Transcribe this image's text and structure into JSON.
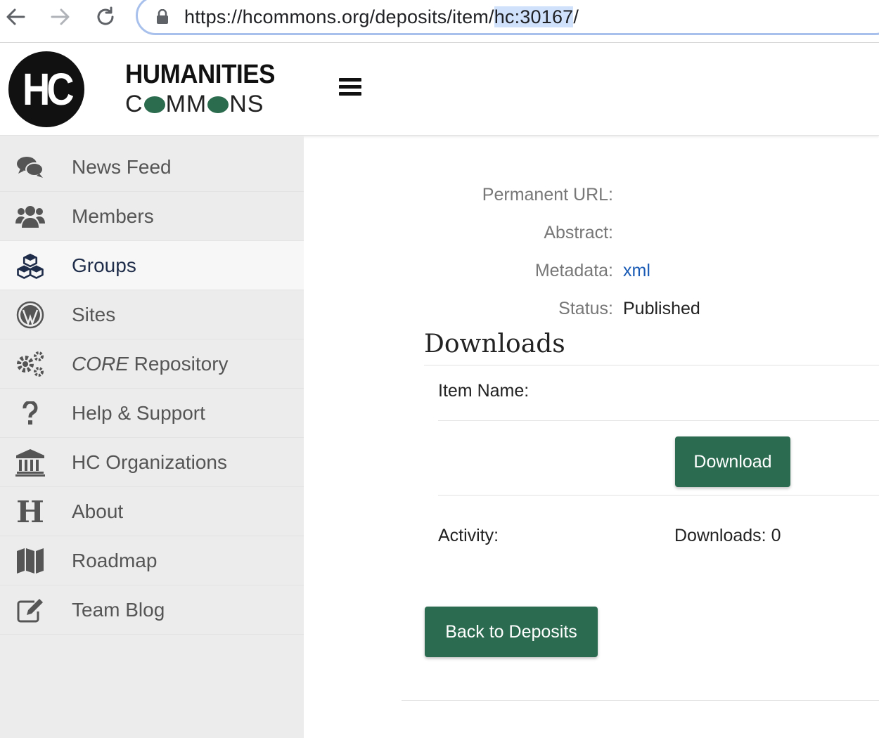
{
  "browser": {
    "url_prefix": "https://hcommons.org/deposits/item/",
    "url_highlight": "hc:30167",
    "url_suffix": "/"
  },
  "header": {
    "logo_text": "HC",
    "brand_top": "HUMANITIES",
    "brand_bottom_parts": [
      "C",
      "MM",
      "NS"
    ]
  },
  "sidebar": {
    "items": [
      {
        "label": "News Feed",
        "icon": "comments-icon"
      },
      {
        "label": "Members",
        "icon": "users-icon"
      },
      {
        "label": "Groups",
        "icon": "cubes-icon",
        "active": true
      },
      {
        "label": "Sites",
        "icon": "wordpress-icon"
      },
      {
        "label_em": "CORE",
        "label": " Repository",
        "icon": "gears-icon"
      },
      {
        "label": "Help & Support",
        "icon": "question-icon"
      },
      {
        "label": "HC Organizations",
        "icon": "institution-icon"
      },
      {
        "label": "About",
        "icon": "h-letter-icon"
      },
      {
        "label": "Roadmap",
        "icon": "map-icon"
      },
      {
        "label": "Team Blog",
        "icon": "edit-icon"
      }
    ]
  },
  "metadata": {
    "permanent_url_label": "Permanent URL:",
    "abstract_label": "Abstract:",
    "metadata_label": "Metadata:",
    "metadata_value": "xml",
    "status_label": "Status:",
    "status_value": "Published"
  },
  "downloads": {
    "heading": "Downloads",
    "item_name_label": "Item Name:",
    "download_button": "Download",
    "activity_label": "Activity:",
    "downloads_count": "Downloads: 0"
  },
  "back_button": "Back to Deposits",
  "colors": {
    "button_green": "#2b6b50",
    "link_blue": "#1a5bb5",
    "sidebar_bg": "#ececec"
  }
}
